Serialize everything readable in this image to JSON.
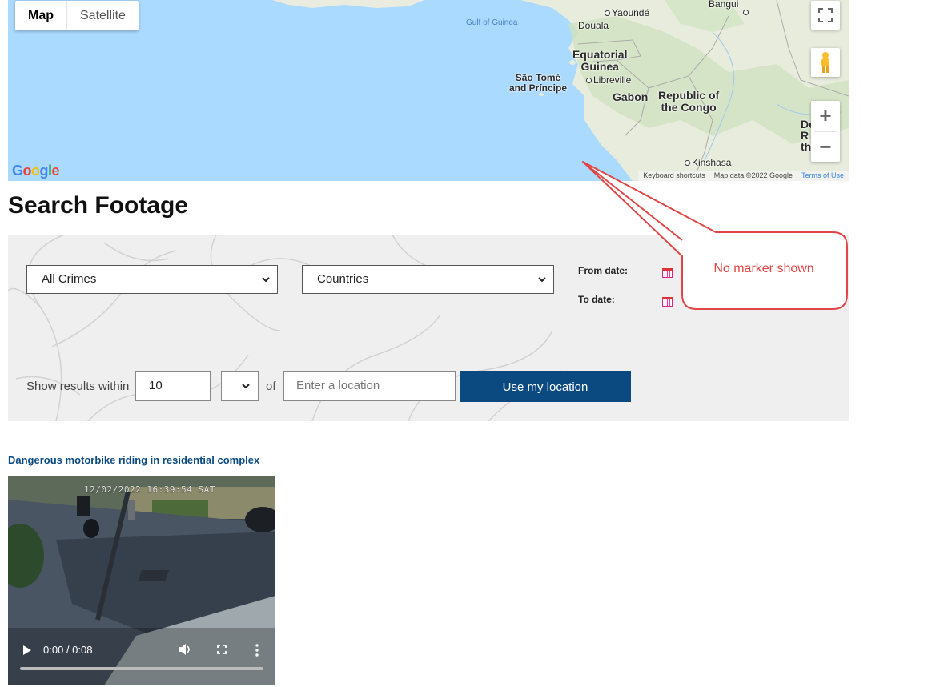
{
  "map": {
    "type_buttons": {
      "map": "Map",
      "satellite": "Satellite"
    },
    "labels": {
      "bangui": "Bangui",
      "yaounde": "Yaoundé",
      "douala": "Douala",
      "gulf": "Gulf of Guinea",
      "eq_guinea": "Equatorial\nGuinea",
      "sao_tome": "São Tomé\nand Príncipe",
      "libreville": "Libreville",
      "gabon": "Gabon",
      "congo": "Republic of\nthe Congo",
      "drc": "De\nR\nth",
      "kinshasa": "Kinshasa"
    },
    "google_logo": "Google",
    "attribution": {
      "shortcuts": "Keyboard shortcuts",
      "data": "Map data ©2022 Google",
      "terms": "Terms of Use"
    },
    "zoom_in": "+",
    "zoom_out": "−",
    "icons": [
      "fullscreen-icon",
      "pegman-icon",
      "google-logo"
    ]
  },
  "callout": {
    "text": "No marker shown",
    "color": "#e14545"
  },
  "search": {
    "title": "Search Footage",
    "crime_select": "All Crimes",
    "country_select": "Countries",
    "from_label": "From date:",
    "to_label": "To date:",
    "within_label": "Show results within",
    "radius_value": "10",
    "unit_value": "",
    "of_label": "of",
    "location_placeholder": "Enter a location",
    "use_location_button": "Use my location",
    "accent": "#0b4a80"
  },
  "results": [
    {
      "title": "Dangerous motorbike riding in residential complex",
      "video": {
        "timestamp": "12/02/2022 16:39:54 SAT",
        "time_display": "0:00 / 0:08"
      }
    }
  ]
}
